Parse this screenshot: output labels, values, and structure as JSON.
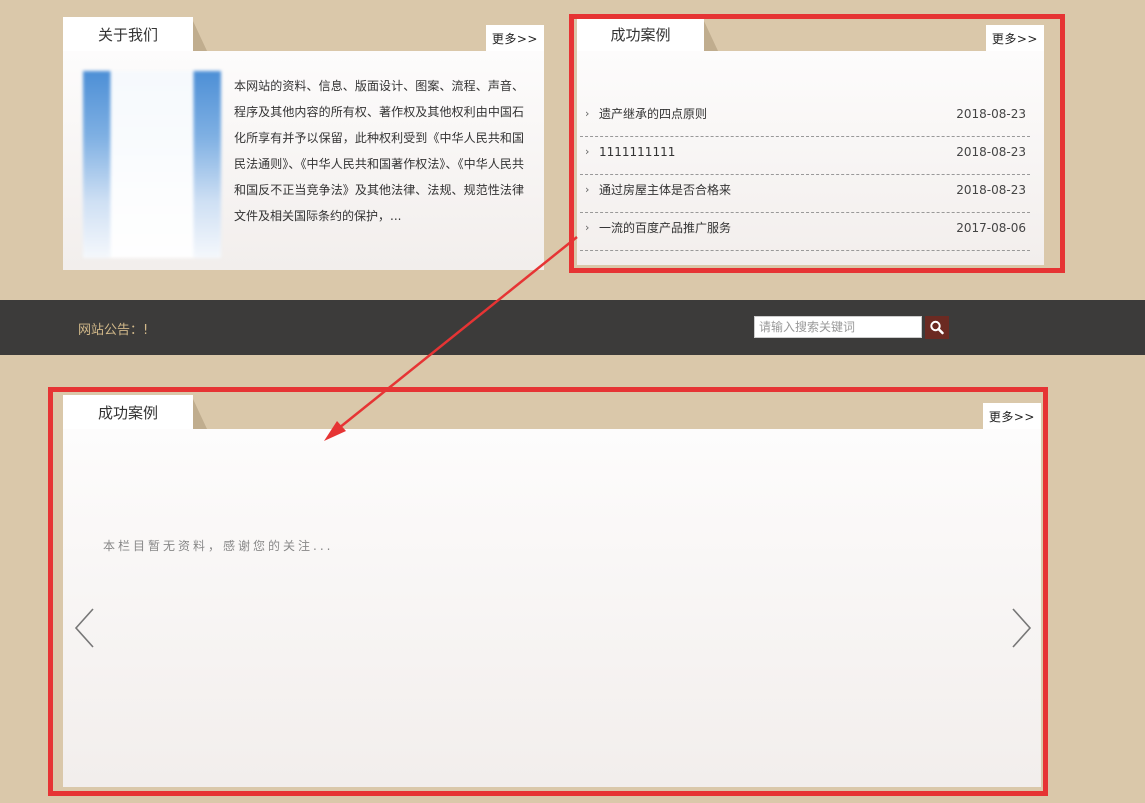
{
  "about": {
    "tab_label": "关于我们",
    "more_label": "更多>>",
    "text": "本网站的资料、信息、版面设计、图案、流程、声音、程序及其他内容的所有权、著作权及其他权利由中国石化所享有并予以保留，此种权利受到《中华人民共和国民法通则》、《中华人民共和国著作权法》、《中华人民共和国反不正当竞争法》及其他法律、法规、规范性法律文件及相关国际条约的保护，..."
  },
  "case_small": {
    "tab_label": "成功案例",
    "more_label": "更多>>",
    "items": [
      {
        "bullet": "›",
        "title": "遗产继承的四点原则",
        "date": "2018-08-23"
      },
      {
        "bullet": "›",
        "title": "1111111111",
        "date": "2018-08-23"
      },
      {
        "bullet": "›",
        "title": "通过房屋主体是否合格来",
        "date": "2018-08-23"
      },
      {
        "bullet": "›",
        "title": "一流的百度产品推广服务",
        "date": "2017-08-06"
      }
    ]
  },
  "notice_bar": {
    "notice": "网站公告：!",
    "search_placeholder": "请输入搜索关键词",
    "search_icon": "magnifier-icon"
  },
  "case_big": {
    "tab_label": "成功案例",
    "more_label": "更多>>",
    "empty_text": "本栏目暂无资料，感谢您的关注...",
    "prev_icon": "chevron-left-icon",
    "next_icon": "chevron-right-icon"
  },
  "colors": {
    "background": "#dac8aa",
    "dark_bar": "#3c3b3a",
    "notice_text": "#d2b98a",
    "search_button": "#6b2a22",
    "annotation": "#e63434"
  }
}
